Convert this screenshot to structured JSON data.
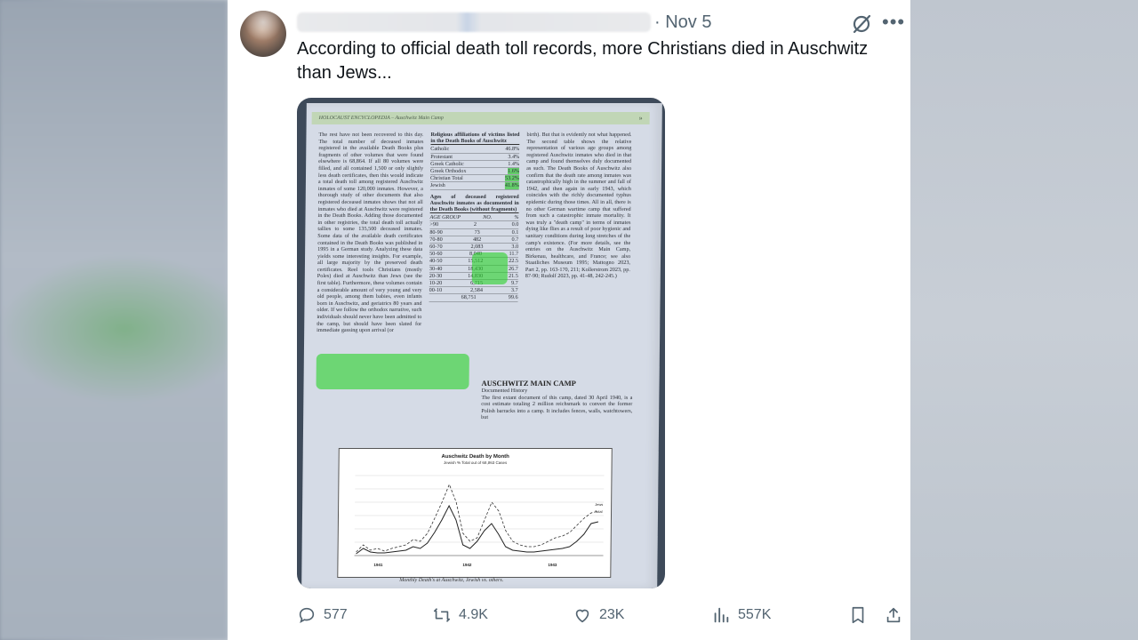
{
  "post": {
    "date": "Nov 5",
    "date_sep": "·",
    "text": "According to official death toll records, more Christians died in Auschwitz than Jews...",
    "more_label": "•••"
  },
  "actions": {
    "replies": "577",
    "reposts": "4.9K",
    "likes": "23K",
    "views": "557K"
  },
  "image": {
    "header": "HOLOCAUST ENCYCLOPEDIA – Auschwitz Main Camp",
    "header_chevron": "»",
    "col1_text": "The rest have not been recovered to this day. The total number of deceased inmates registered in the available Death Books plus fragments of other volumes that were found elsewhere is 68,864. If all 80 volumes were filled, and all contained 1,500 or only slightly less death certificates, then this would indicate a total death toll among registered Auschwitz inmates of some 120,000 inmates. However, a thorough study of other documents that also registered deceased inmates shows that not all inmates who died at Auschwitz were registered in the Death Books. Adding those documented in other registries, the total death toll actually tallies to some 135,500 deceased inmates. Some data of the available death certificates contained in the Death Books was published in 1995 in a German study. Analyzing these data yields some interesting insights. For example, all large majority by the preserved death certificates. Reel tools Christians (mostly Poles) died at Auschwitz than Jews (see the first table). Furthermore, these volumes contain a considerable amount of very young and very old people, among them babies, even infants born in Auschwitz, and geriatrics 80 years and older. If we follow the orthodox narrative, such individuals should never have been admitted to the camp, but should have been slated for immediate gassing upon arrival (or",
    "table1_title": "Religious affiliations of victims listed in the Death Books of Auschwitz",
    "table1": [
      {
        "label": "Catholic",
        "value": "46.8%"
      },
      {
        "label": "Protestant",
        "value": "3.4%"
      },
      {
        "label": "Greek Catholic",
        "value": "1.4%"
      },
      {
        "label": "Greek Orthodox",
        "value": "1.6%"
      },
      {
        "label": "Christian Total",
        "value": "53.2%"
      },
      {
        "label": "Jewish",
        "value": "41.8%"
      }
    ],
    "table2_title": "Ages of deceased registered Auschwitz inmates as documented in the Death Books (without fragments)",
    "table2_head": [
      "AGE GROUP",
      "NO.",
      "%"
    ],
    "table2": [
      [
        ">90",
        "2",
        "0.0"
      ],
      [
        "80-90",
        "73",
        "0.1"
      ],
      [
        "70-80",
        "482",
        "0.7"
      ],
      [
        "60-70",
        "2,083",
        "3.0"
      ],
      [
        "50-60",
        "8,040",
        "11.7"
      ],
      [
        "40-50",
        "15,512",
        "22.5"
      ],
      [
        "30-40",
        "18,430",
        "26.7"
      ],
      [
        "20-30",
        "14,830",
        "21.5"
      ],
      [
        "10-20",
        "6,715",
        "9.7"
      ],
      [
        "00-10",
        "2,584",
        "3.7"
      ],
      [
        "",
        "68,751",
        "99.6"
      ]
    ],
    "col3_text": "birth). But that is evidently not what happened. The second table shows the relative representation of various age groups among registered Auschwitz inmates who died in that camp and found themselves duly documented as such. The Death Books of Auschwitz also confirm that the death rate among inmates was catastrophically high in the summer and fall of 1942, and then again in early 1943, which coincides with the richly documented typhus epidemic during those times. All in all, there is no other German wartime camp that suffered from such a catastrophic inmate mortality. It was truly a \"death camp\" in terms of inmates dying like flies as a result of poor hygienic and sanitary conditions during long stretches of the camp's existence. (For more details, see the entries on the Auschwitz Main Camp, Birkenau, healthcare, and France; see also Staatliches Museum 1995; Mattogno 2023, Part 2, pp. 163-170, 211; Kollerstrom 2023, pp. 87-90; Rudolf 2023, pp. 41-48, 242-245.)",
    "section_title": "AUSCHWITZ MAIN CAMP",
    "section_sub": "Documented History",
    "section_text": "The first extant document of this camp, dated 30 April 1940, is a cost estimate totaling 2 million reichsmark to convert the former Polish barracks into a camp. It includes fences, walls, watchtowers, but",
    "chart_title": "Auschwitz Death by Month",
    "chart_subtitle": "Jewish % Total out of 68,863 Cases",
    "chart_legend": [
      "Jews",
      "Total"
    ],
    "chart_years": [
      "1941",
      "1942",
      "1943"
    ],
    "caption": "Monthly Death's at Auschwitz, Jewish vs. others."
  }
}
